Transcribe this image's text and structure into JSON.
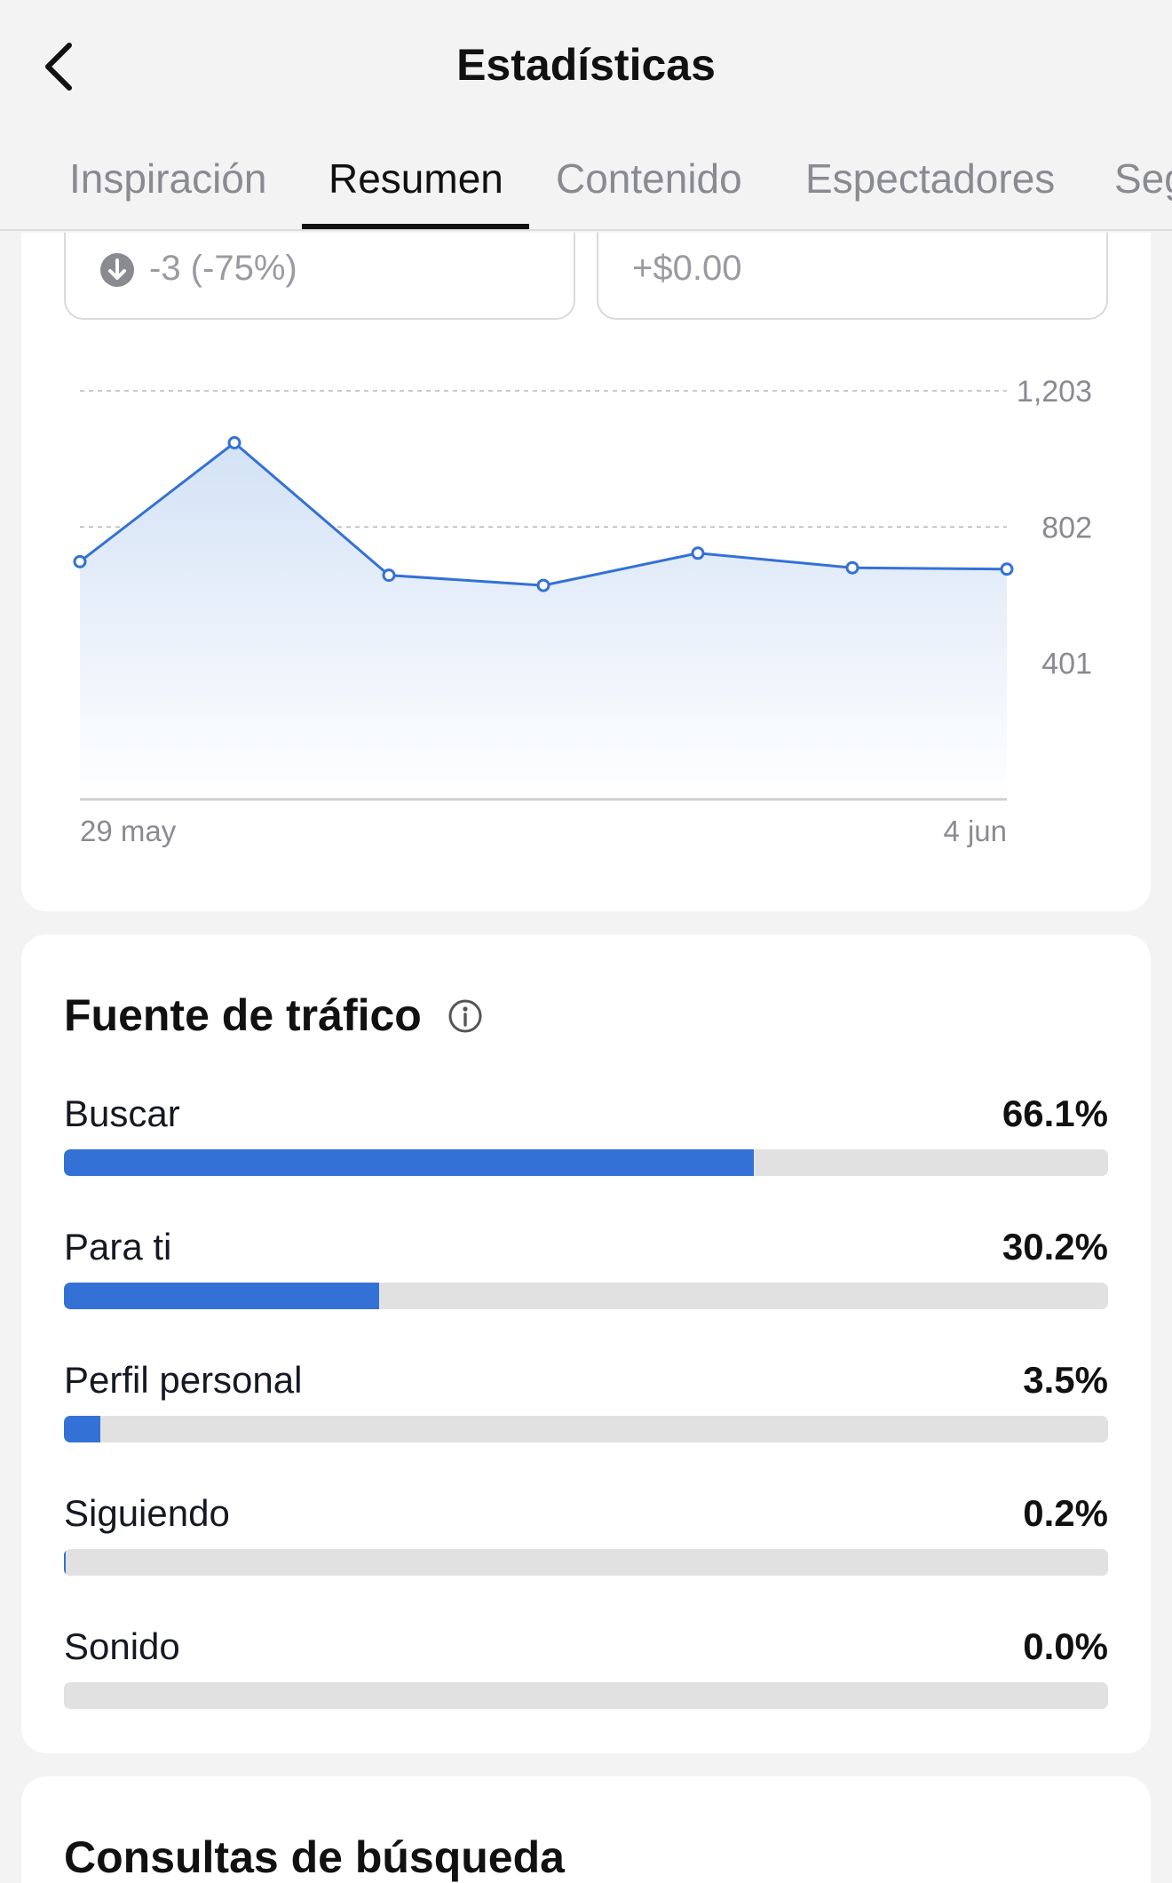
{
  "header": {
    "title": "Estadísticas",
    "back_icon": "chevron-left-icon"
  },
  "tabs": [
    {
      "label": "Inspiración",
      "active": false
    },
    {
      "label": "Resumen",
      "active": true
    },
    {
      "label": "Contenido",
      "active": false
    },
    {
      "label": "Espectadores",
      "active": false
    },
    {
      "label": "Seguidores",
      "active": false
    }
  ],
  "metrics": {
    "left": {
      "icon": "arrow-down-circle-icon",
      "text": "-3 (-75%)"
    },
    "right": {
      "text": "+$0.00"
    }
  },
  "chart_data": {
    "type": "line",
    "x": [
      "29 may",
      "30 may",
      "31 may",
      "1 jun",
      "2 jun",
      "3 jun",
      "4 jun"
    ],
    "values": [
      700,
      1050,
      660,
      630,
      725,
      682,
      678
    ],
    "y_ticks": [
      "1,203",
      "802",
      "401"
    ],
    "ylim": [
      0,
      1203
    ],
    "x_tick_labels": [
      "29 may",
      "4 jun"
    ],
    "grid": true,
    "line_color": "#3471d6",
    "fill_color": "#d6e4f7"
  },
  "traffic": {
    "title": "Fuente de tráfico",
    "info_icon": "info-circle-icon",
    "rows": [
      {
        "label": "Buscar",
        "value": "66.1%",
        "fraction": 0.661
      },
      {
        "label": "Para ti",
        "value": "30.2%",
        "fraction": 0.302
      },
      {
        "label": "Perfil personal",
        "value": "3.5%",
        "fraction": 0.035
      },
      {
        "label": "Siguiendo",
        "value": "0.2%",
        "fraction": 0.002
      },
      {
        "label": "Sonido",
        "value": "0.0%",
        "fraction": 0.0
      }
    ],
    "bar_color": "#3471d6"
  },
  "next_section": {
    "title": "Consultas de búsqueda"
  }
}
